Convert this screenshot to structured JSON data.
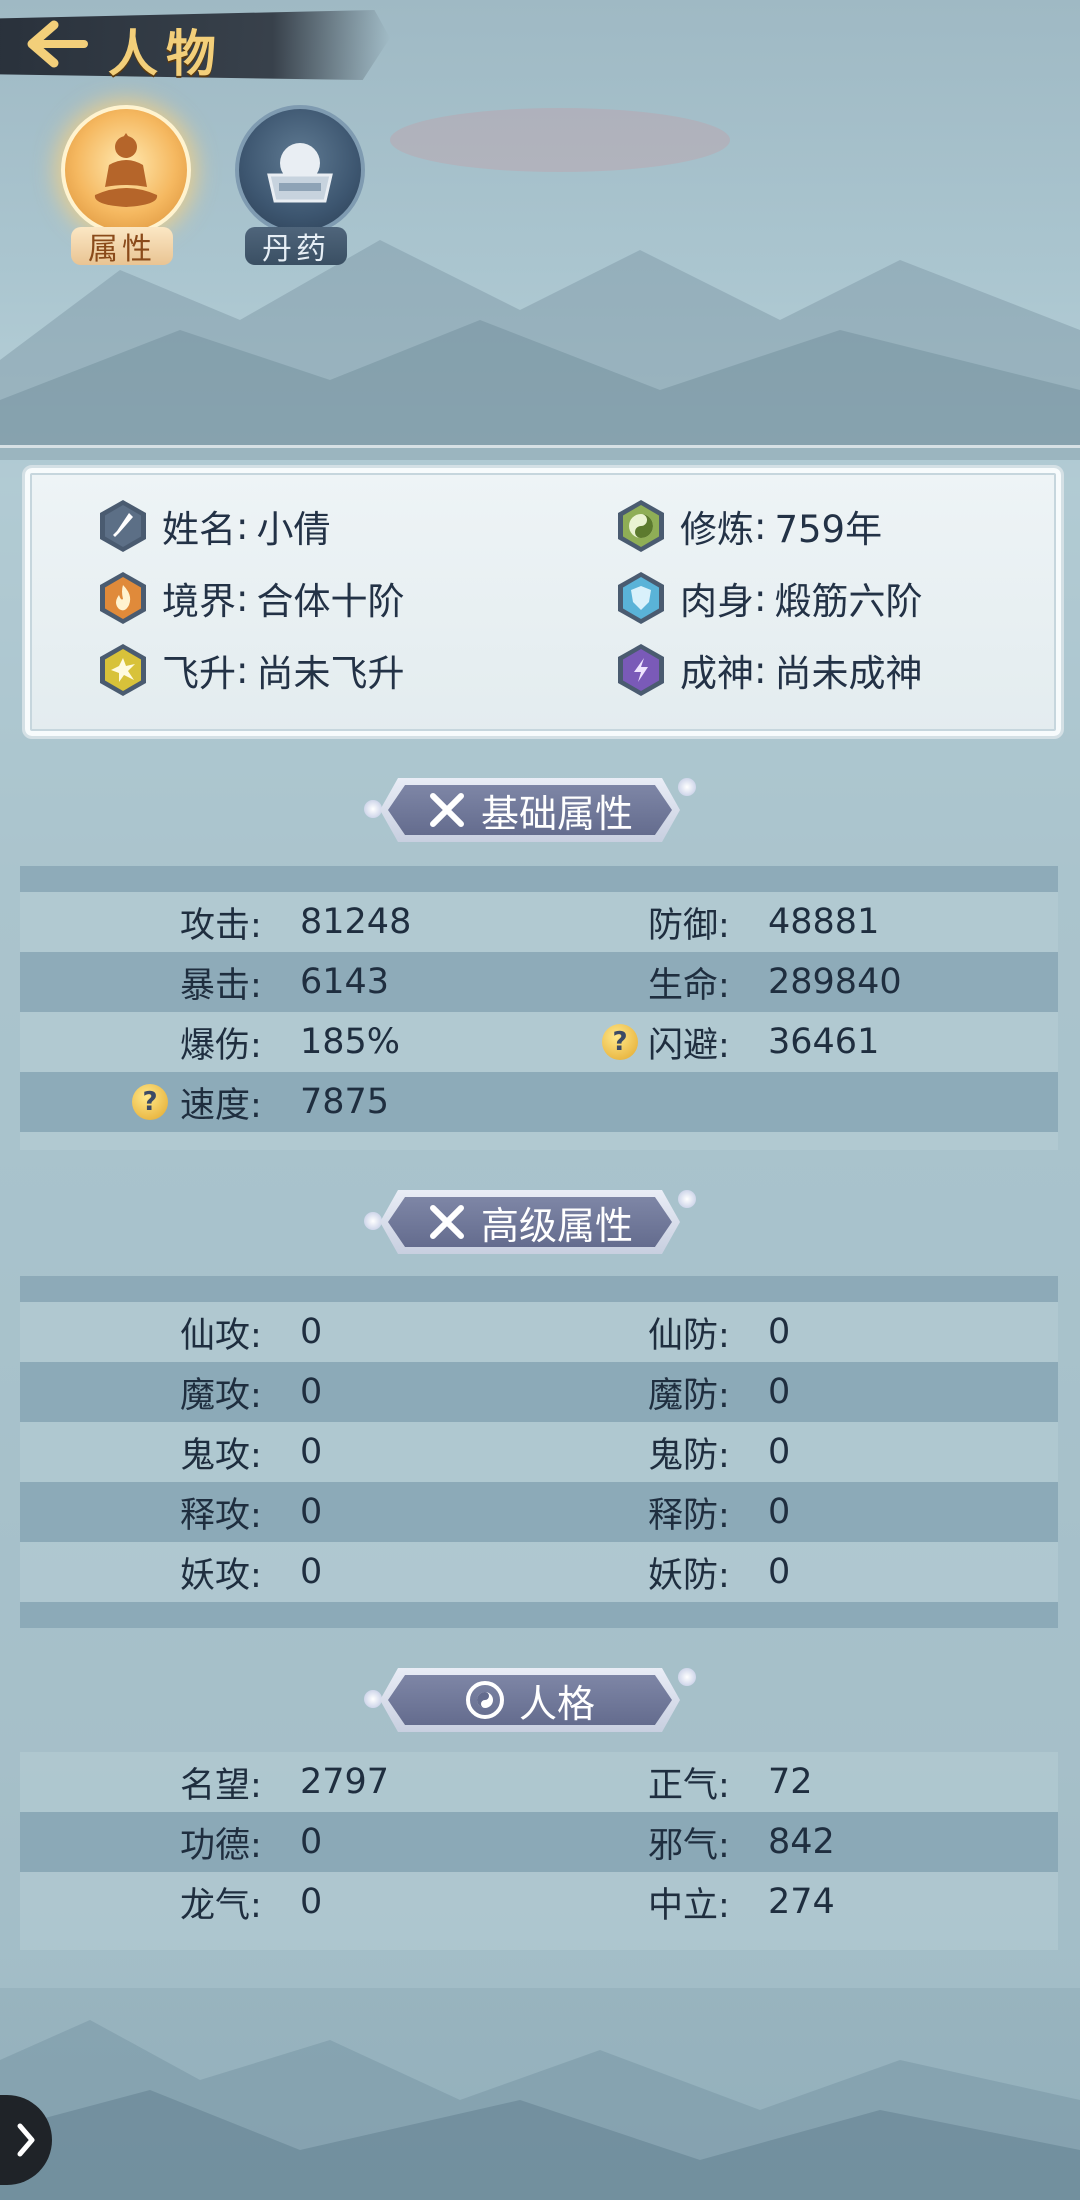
{
  "header": {
    "title": "人物"
  },
  "tabs": [
    {
      "label": "属性",
      "icon": "meditating-figure-icon",
      "active": true
    },
    {
      "label": "丹药",
      "icon": "pill-furnace-icon",
      "active": false
    }
  ],
  "profile": {
    "name": {
      "label": "姓名",
      "value": "小倩",
      "icon": "sword-icon"
    },
    "cultivation": {
      "label": "修炼",
      "value": "759年",
      "icon": "yin-yang-icon"
    },
    "realm": {
      "label": "境界",
      "value": "合体十阶",
      "icon": "flame-icon"
    },
    "body": {
      "label": "肉身",
      "value": "煅筋六阶",
      "icon": "shield-icon"
    },
    "ascend": {
      "label": "飞升",
      "value": "尚未飞升",
      "icon": "burst-icon"
    },
    "deify": {
      "label": "成神",
      "value": "尚未成神",
      "icon": "lightning-icon"
    },
    "sep": ":"
  },
  "basic": {
    "title": "基础属性",
    "rows": [
      {
        "l_label": "攻击:",
        "l_value": "81248",
        "r_label": "防御:",
        "r_value": "48881"
      },
      {
        "l_label": "暴击:",
        "l_value": "6143",
        "r_label": "生命:",
        "r_value": "289840"
      },
      {
        "l_label": "爆伤:",
        "l_value": "185%",
        "r_label": "闪避:",
        "r_value": "36461"
      },
      {
        "l_label": "速度:",
        "l_value": "7875",
        "r_label": "",
        "r_value": ""
      }
    ]
  },
  "advanced": {
    "title": "高级属性",
    "rows": [
      {
        "l_label": "仙攻:",
        "l_value": "0",
        "r_label": "仙防:",
        "r_value": "0"
      },
      {
        "l_label": "魔攻:",
        "l_value": "0",
        "r_label": "魔防:",
        "r_value": "0"
      },
      {
        "l_label": "鬼攻:",
        "l_value": "0",
        "r_label": "鬼防:",
        "r_value": "0"
      },
      {
        "l_label": "释攻:",
        "l_value": "0",
        "r_label": "释防:",
        "r_value": "0"
      },
      {
        "l_label": "妖攻:",
        "l_value": "0",
        "r_label": "妖防:",
        "r_value": "0"
      }
    ]
  },
  "personality": {
    "title": "人格",
    "rows": [
      {
        "l_label": "名望:",
        "l_value": "2797",
        "r_label": "正气:",
        "r_value": "72"
      },
      {
        "l_label": "功德:",
        "l_value": "0",
        "r_label": "邪气:",
        "r_value": "842"
      },
      {
        "l_label": "龙气:",
        "l_value": "0",
        "r_label": "中立:",
        "r_value": "274"
      }
    ]
  },
  "help_mark": "?"
}
